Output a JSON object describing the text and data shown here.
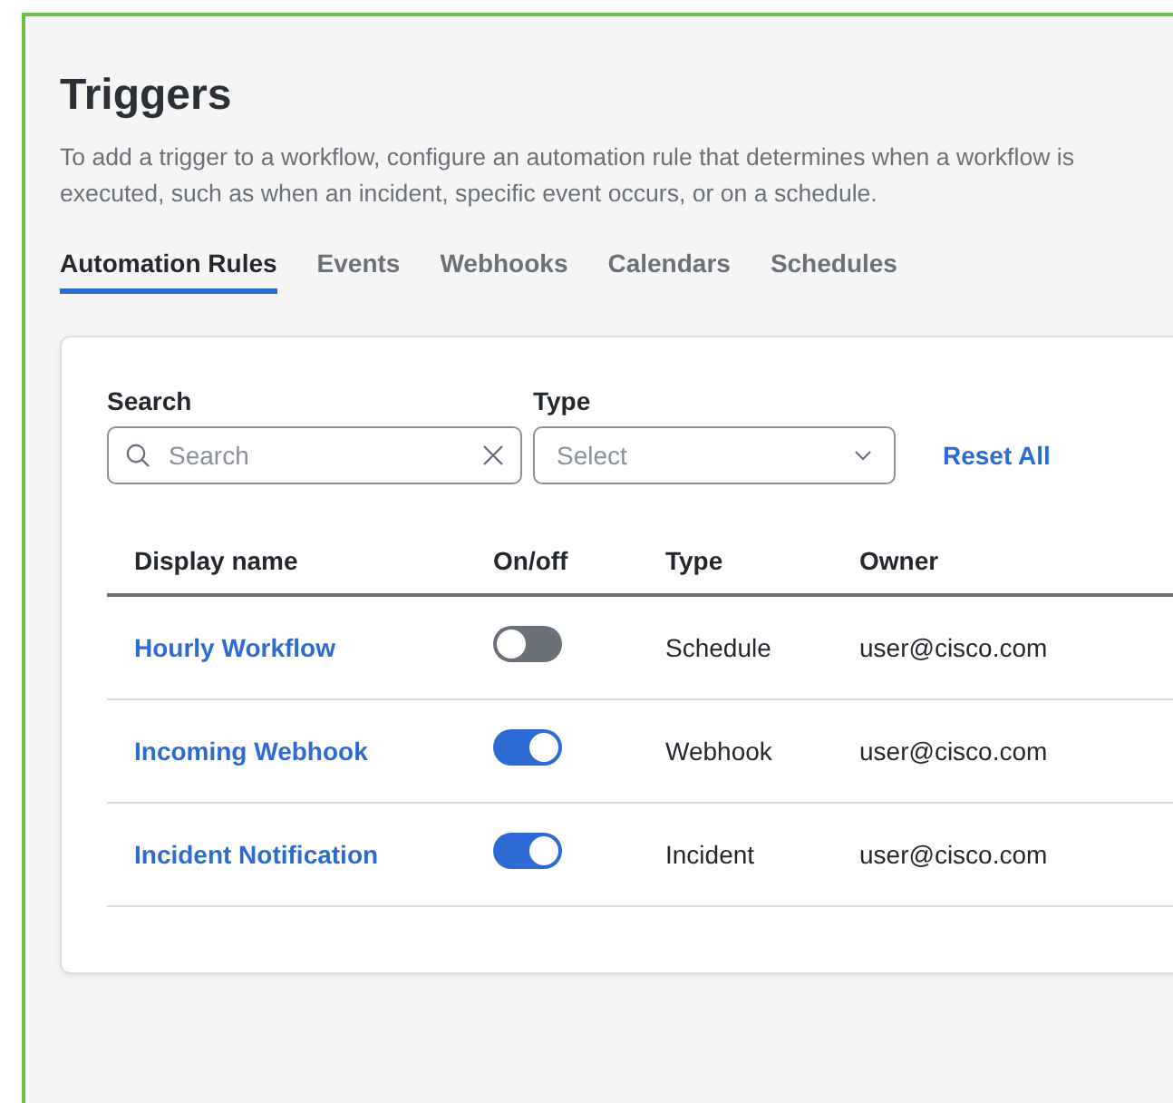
{
  "page": {
    "title": "Triggers",
    "description": "To add a trigger to a workflow, configure an automation rule that determines when a workflow is executed, such as when an incident, specific event occurs, or on a schedule."
  },
  "tabs": [
    {
      "label": "Automation Rules",
      "selected": true
    },
    {
      "label": "Events",
      "selected": false
    },
    {
      "label": "Webhooks",
      "selected": false
    },
    {
      "label": "Calendars",
      "selected": false
    },
    {
      "label": "Schedules",
      "selected": false
    }
  ],
  "filters": {
    "search": {
      "label": "Search",
      "placeholder": "Search"
    },
    "type": {
      "label": "Type",
      "placeholder": "Select"
    },
    "reset": "Reset All"
  },
  "table": {
    "columns": [
      "Display name",
      "On/off",
      "Type",
      "Owner"
    ],
    "rows": [
      {
        "name": "Hourly Workflow",
        "on": false,
        "type": "Schedule",
        "owner": "user@cisco.com"
      },
      {
        "name": "Incoming Webhook",
        "on": true,
        "type": "Webhook",
        "owner": "user@cisco.com"
      },
      {
        "name": "Incident Notification",
        "on": true,
        "type": "Incident",
        "owner": "user@cisco.com"
      }
    ]
  }
}
